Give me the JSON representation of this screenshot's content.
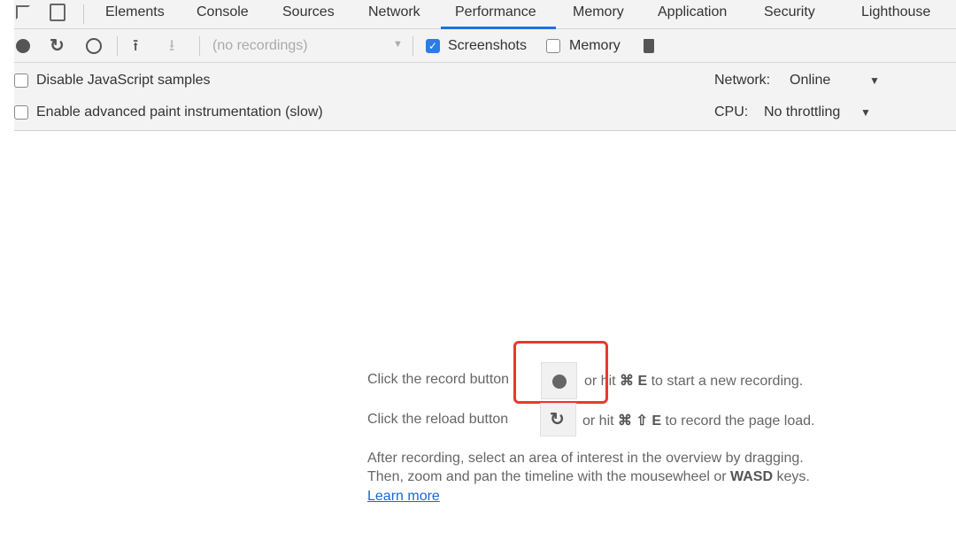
{
  "tabs": [
    "Elements",
    "Console",
    "Sources",
    "Network",
    "Performance",
    "Memory",
    "Application",
    "Security",
    "Lighthouse"
  ],
  "active_tab": "Performance",
  "toolbar": {
    "recordings_select": "(no recordings)",
    "screenshots_label": "Screenshots",
    "screenshots_checked": true,
    "memory_label": "Memory",
    "memory_checked": false
  },
  "settings": {
    "disable_js_samples": "Disable JavaScript samples",
    "advanced_paint": "Enable advanced paint instrumentation (slow)",
    "network_label": "Network:",
    "network_value": "Online",
    "cpu_label": "CPU:",
    "cpu_value": "No throttling"
  },
  "landing": {
    "record_pre": "Click the record button",
    "record_post": "or hit",
    "record_key": "⌘ E",
    "record_tail": "to start a new recording.",
    "reload_pre": "Click the reload button",
    "reload_post": "or hit",
    "reload_key": "⌘ ⇧ E",
    "reload_tail": "to record the page load.",
    "after_line1": "After recording, select an area of interest in the overview by dragging.",
    "after_line2_pre": "Then, zoom and pan the timeline with the mousewheel or",
    "after_line2_key": "WASD",
    "after_line2_tail": "keys.",
    "learn_more": "Learn more"
  },
  "highlight_color": "#e8392f"
}
